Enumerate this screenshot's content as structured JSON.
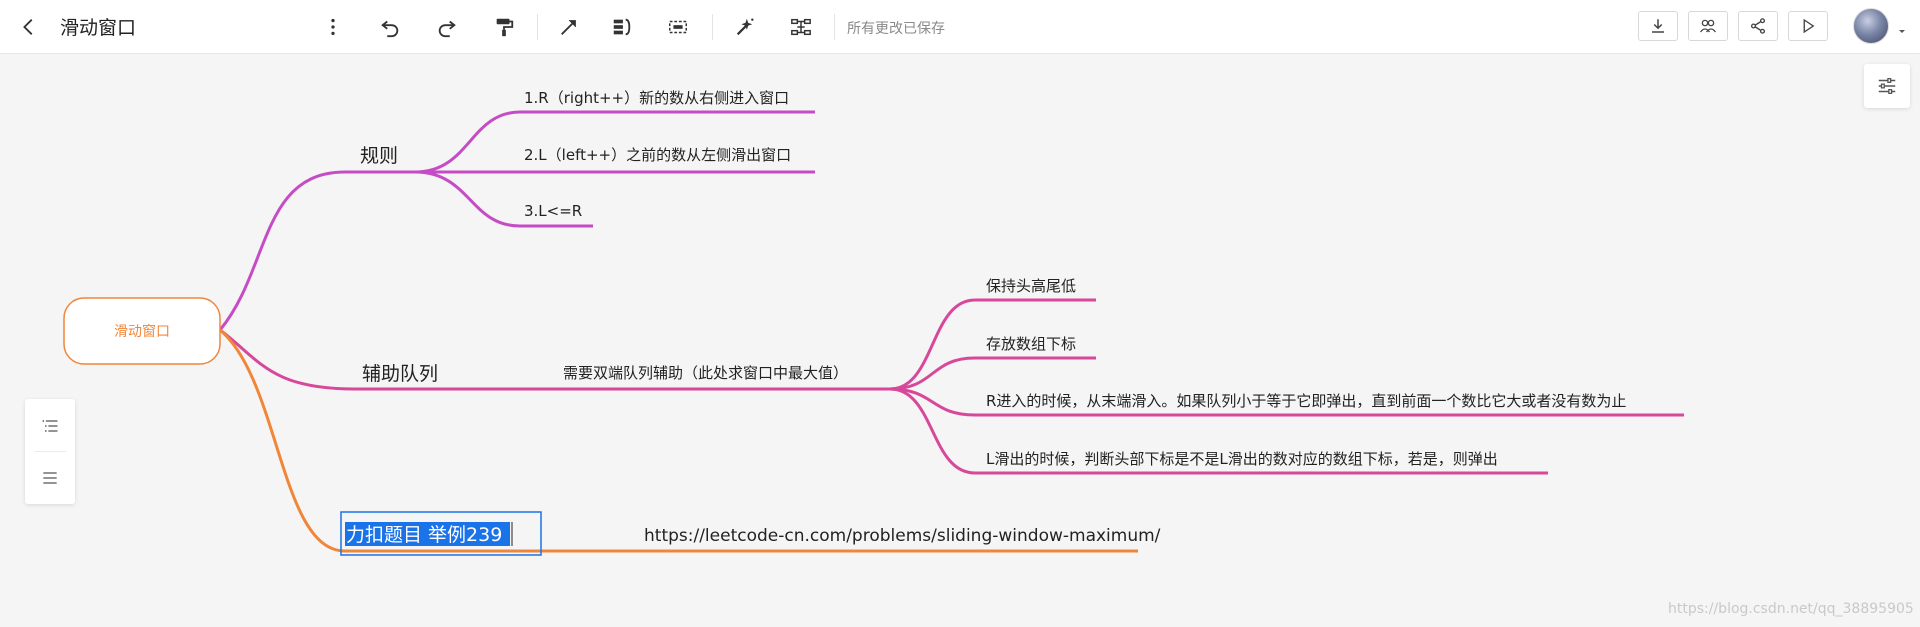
{
  "header": {
    "title": "滑动窗口",
    "save_status": "所有更改已保存"
  },
  "colors": {
    "branch_rules": "#c54cc5",
    "branch_queue": "#d8489a",
    "branch_leetcode": "#f0863a",
    "root_border": "#f0863a",
    "root_text": "#f0863a",
    "selection": "#1a73e8"
  },
  "mindmap": {
    "root": "滑动窗口",
    "rules": {
      "label": "规则",
      "children": [
        "1.R（right++）新的数从右侧进入窗口",
        "2.L（left++）之前的数从左侧滑出窗口",
        "3.L<=R"
      ]
    },
    "queue": {
      "label": "辅助队列",
      "note": "需要双端队列辅助（此处求窗口中最大值）",
      "children": [
        "保持头高尾低",
        "存放数组下标",
        "R进入的时候，从末端滑入。如果队列小于等于它即弹出，直到前面一个数比它大或者没有数为止",
        "L滑出的时候，判断头部下标是不是L滑出的数对应的数组下标，若是，则弹出"
      ]
    },
    "leetcode": {
      "label": "力扣题目 举例239",
      "url": "https://leetcode-cn.com/problems/sliding-window-maximum/"
    }
  },
  "watermark": "https://blog.csdn.net/qq_38895905"
}
